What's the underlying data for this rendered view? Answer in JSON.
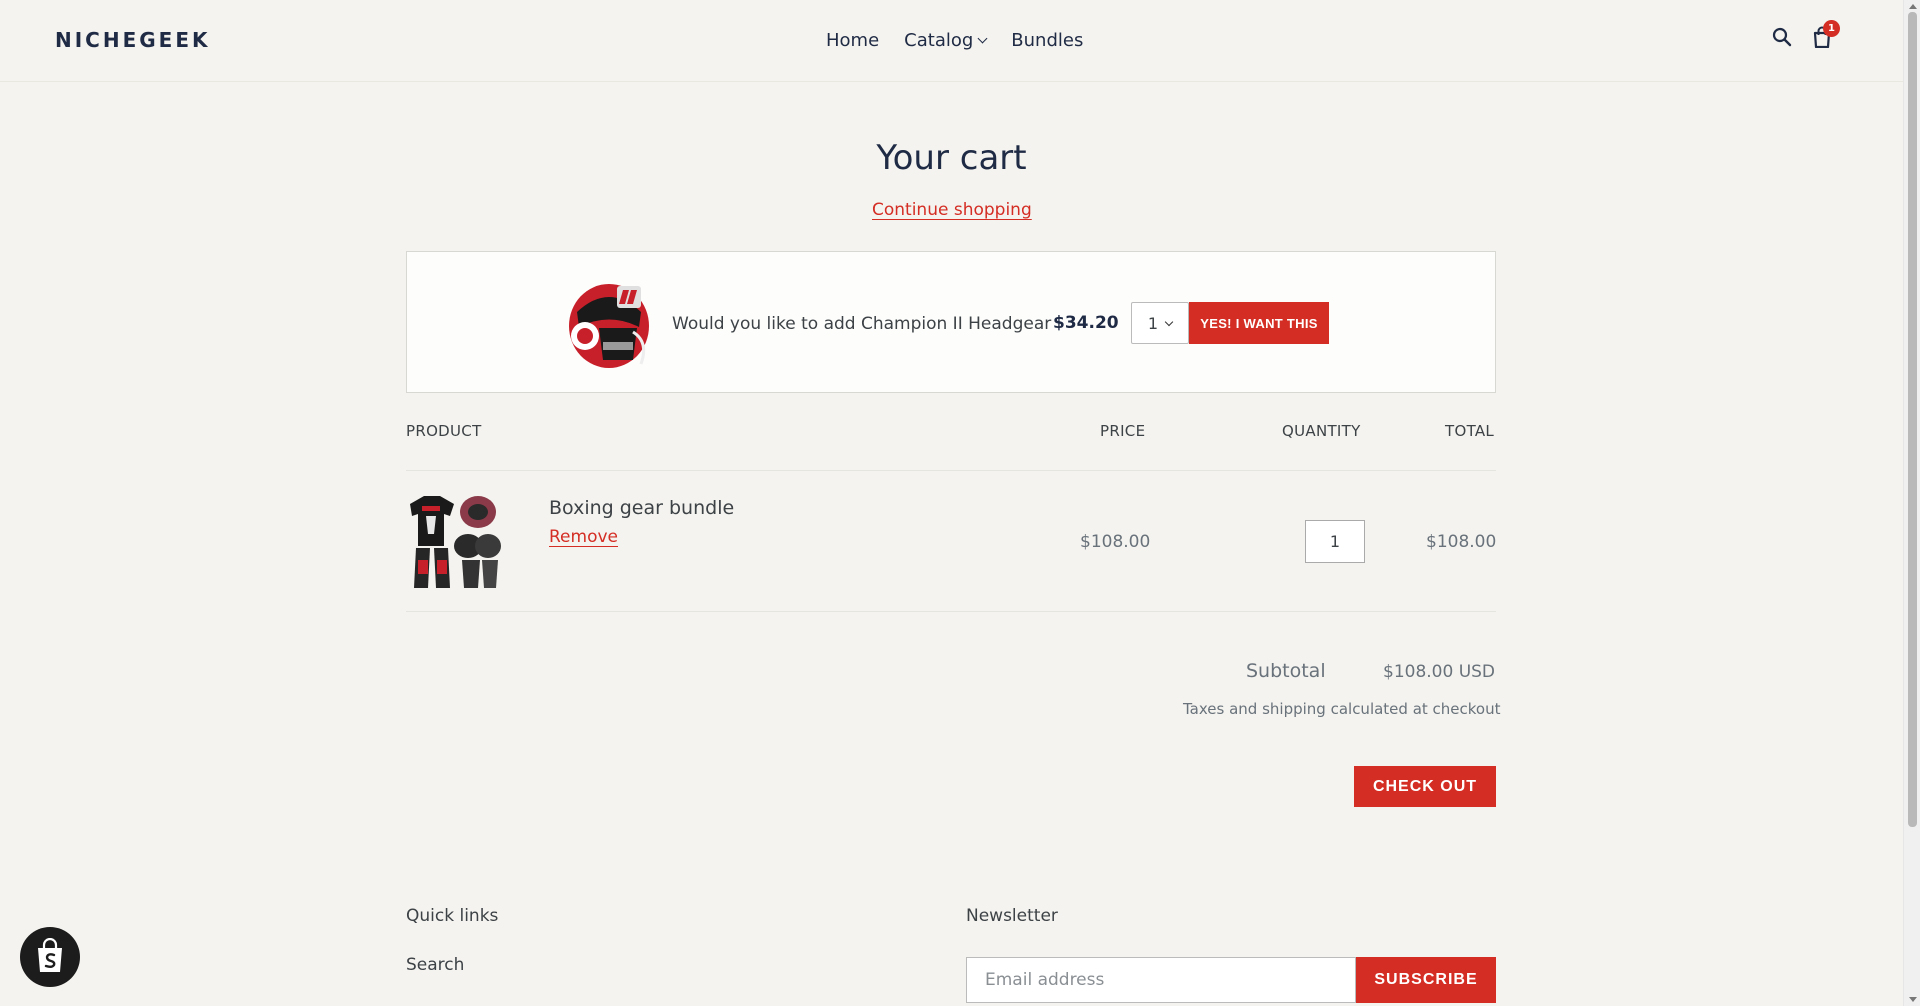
{
  "header": {
    "logo": "NICHEGEEK",
    "nav": [
      "Home",
      "Catalog",
      "Bundles"
    ],
    "cart_count": "1"
  },
  "main": {
    "title": "Your cart",
    "continue_link": "Continue shopping"
  },
  "upsell": {
    "text": "Would you like to add Champion II Headgear",
    "price": "$34.20",
    "qty": "1",
    "button": "YES! I WANT THIS"
  },
  "table": {
    "headers": [
      "PRODUCT",
      "PRICE",
      "QUANTITY",
      "TOTAL"
    ],
    "item": {
      "name": "Boxing gear bundle",
      "remove": "Remove",
      "price": "$108.00",
      "quantity": "1",
      "total": "$108.00"
    }
  },
  "summary": {
    "subtotal_label": "Subtotal",
    "subtotal_value": "$108.00 USD",
    "taxes_note": "Taxes and shipping calculated at checkout",
    "checkout_button": "CHECK OUT"
  },
  "footer": {
    "quick_links_heading": "Quick links",
    "quick_links": [
      "Search"
    ],
    "newsletter_heading": "Newsletter",
    "email_placeholder": "Email address",
    "subscribe_button": "SUBSCRIBE"
  },
  "colors": {
    "accent": "#d42d24",
    "navy": "#1f2a44",
    "background": "#f4f3ef"
  }
}
